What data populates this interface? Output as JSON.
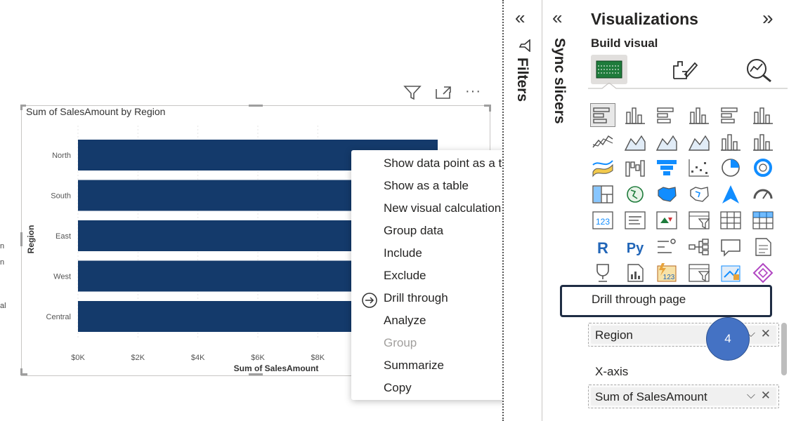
{
  "canvas": {
    "edge_texts": [
      "n",
      "n",
      "al"
    ]
  },
  "visual": {
    "header_icons": [
      "filter-icon",
      "focus-mode-icon",
      "more-options-icon"
    ],
    "more_label": "···"
  },
  "chart_data": {
    "type": "bar",
    "orientation": "horizontal",
    "title": "Sum of SalesAmount by Region",
    "xlabel": "Sum of SalesAmount",
    "ylabel": "Region",
    "categories": [
      "North",
      "South",
      "East",
      "West",
      "Central"
    ],
    "values": [
      12000,
      12000,
      12000,
      12000,
      12000
    ],
    "xticks": [
      "$0K",
      "$2K",
      "$4K",
      "$6K",
      "$8K"
    ],
    "xlim": [
      0,
      12000
    ],
    "bar_color": "#143a6b",
    "grid": true
  },
  "context_menu": {
    "items": [
      {
        "label": "Show data point as a table",
        "submenu": false,
        "disabled": false,
        "icon": ""
      },
      {
        "label": "Show as a table",
        "submenu": false,
        "disabled": false,
        "icon": ""
      },
      {
        "label": "New visual calculation",
        "submenu": false,
        "disabled": false,
        "icon": ""
      },
      {
        "label": "Group data",
        "submenu": false,
        "disabled": false,
        "icon": ""
      },
      {
        "label": "Include",
        "submenu": false,
        "disabled": false,
        "icon": ""
      },
      {
        "label": "Exclude",
        "submenu": false,
        "disabled": false,
        "icon": ""
      },
      {
        "label": "Drill through",
        "submenu": true,
        "disabled": false,
        "icon": "drill-through-icon"
      },
      {
        "label": "Analyze",
        "submenu": true,
        "disabled": false,
        "icon": ""
      },
      {
        "label": "Group",
        "submenu": false,
        "disabled": true,
        "icon": ""
      },
      {
        "label": "Summarize",
        "submenu": false,
        "disabled": false,
        "icon": ""
      },
      {
        "label": "Copy",
        "submenu": true,
        "disabled": false,
        "icon": ""
      }
    ]
  },
  "filters_pane": {
    "label": "Filters",
    "collapse_glyph": "«"
  },
  "sync_pane": {
    "label": "Sync slicers",
    "collapse_glyph": "«"
  },
  "visualizations": {
    "title": "Visualizations",
    "expand_glyph": "»",
    "build_visual": "Build visual",
    "tabs": [
      "build-visual-icon",
      "format-visual-icon",
      "analytics-icon"
    ],
    "gallery_text": {
      "r": "R",
      "py": "Py",
      "kpi": "123"
    },
    "wells": [
      {
        "label": "",
        "field": "Region"
      },
      {
        "label": "X-axis",
        "field": "Sum of SalesAmount"
      }
    ]
  },
  "submenu": {
    "label": "Drill through page"
  },
  "step_badge": "4",
  "colors": {
    "accent": "#118dff",
    "bar": "#143a6b",
    "badge": "#4472c4",
    "callout_border": "#1f2d44"
  }
}
